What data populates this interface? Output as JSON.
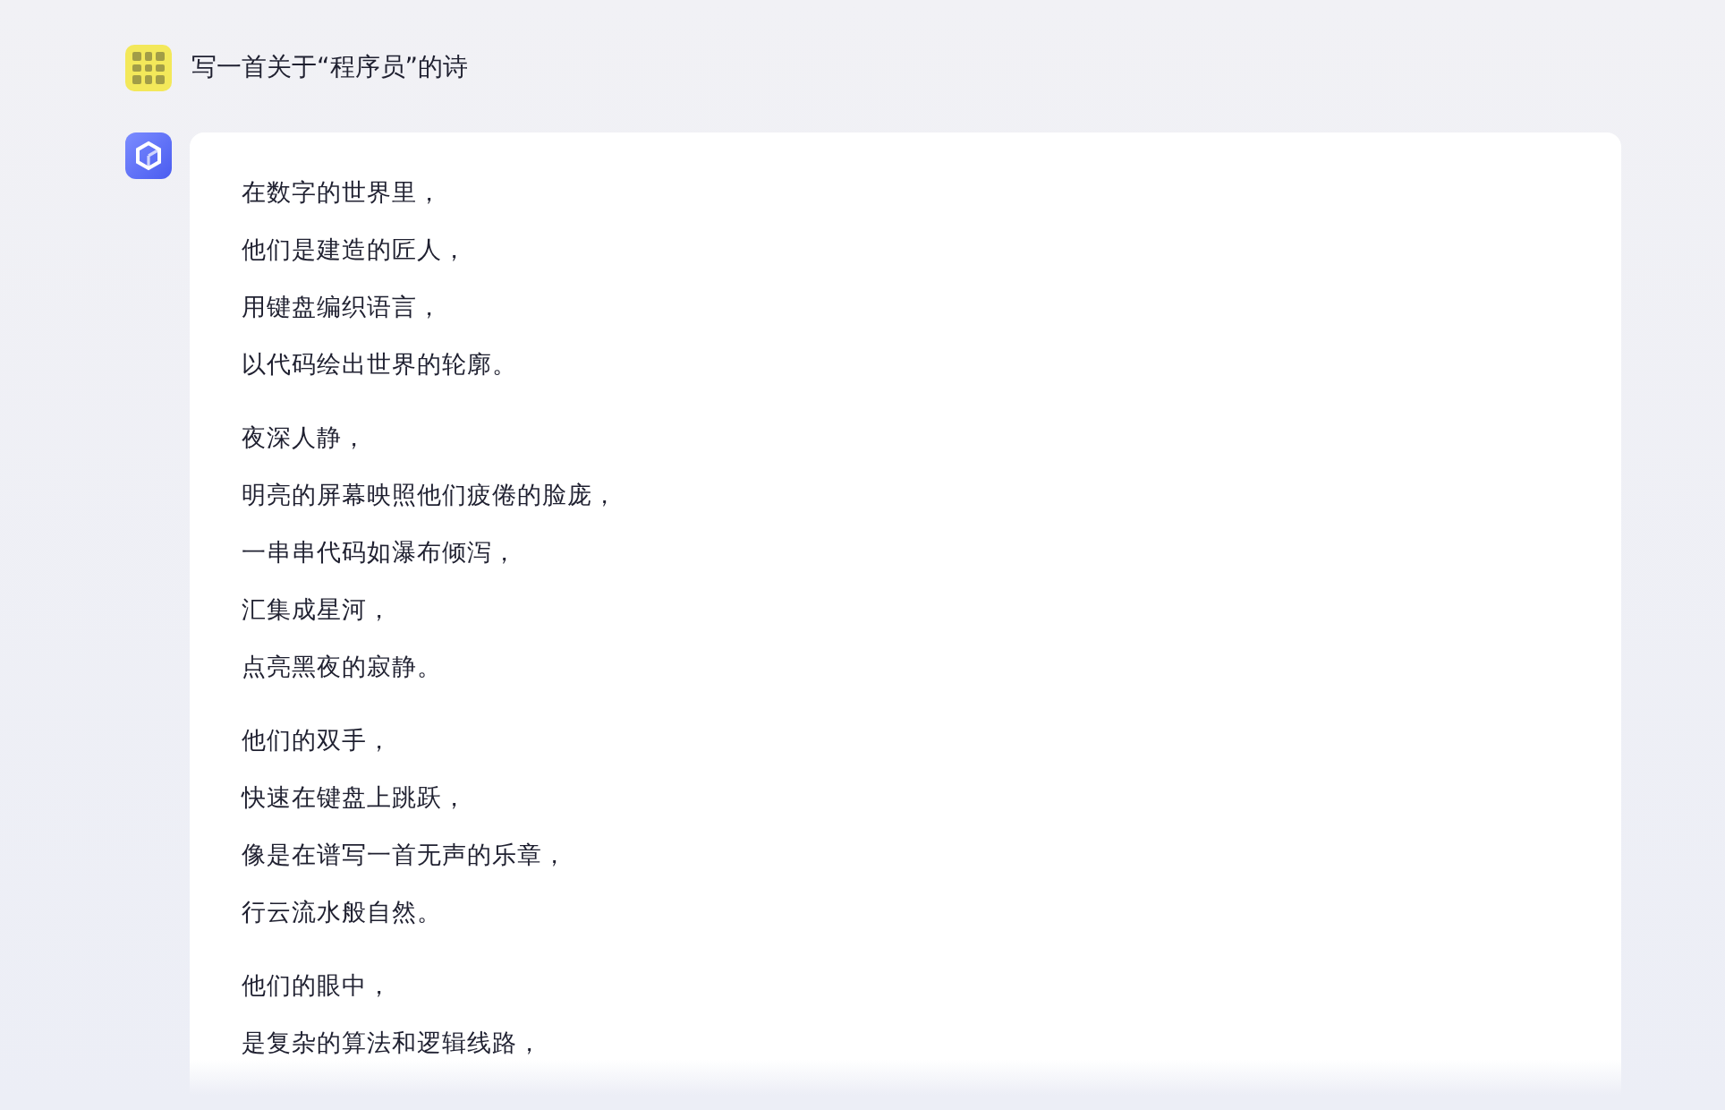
{
  "user_message": {
    "text": "写一首关于“程序员”的诗"
  },
  "reply": {
    "stanzas": [
      [
        "在数字的世界里，",
        "他们是建造的匠人，",
        "用键盘编织语言，",
        "以代码绘出世界的轮廓。"
      ],
      [
        "夜深人静，",
        "明亮的屏幕映照他们疲倦的脸庞，",
        "一串串代码如瀑布倾泻，",
        "汇集成星河，",
        "点亮黑夜的寂静。"
      ],
      [
        "他们的双手，",
        "快速在键盘上跳跃，",
        "像是在谱写一首无声的乐章，",
        "行云流水般自然。"
      ],
      [
        "他们的眼中，",
        "是复杂的算法和逻辑线路，"
      ]
    ]
  }
}
